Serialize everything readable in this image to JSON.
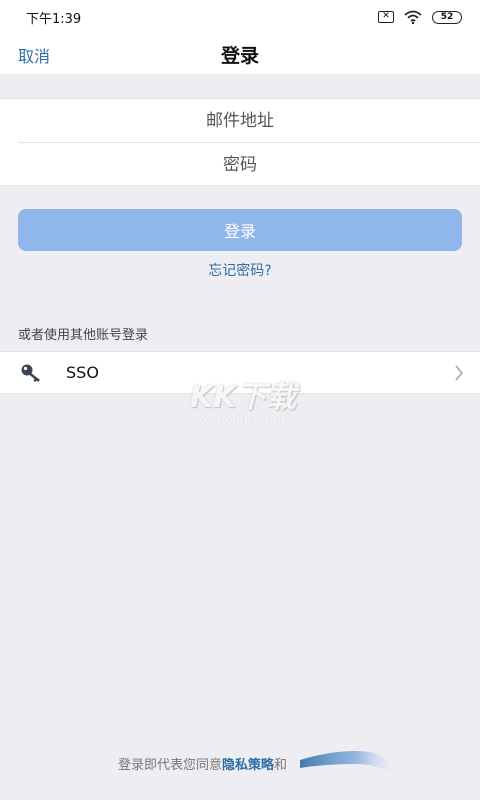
{
  "status_bar": {
    "time": "下午1:39",
    "battery": "52",
    "sim": "✕"
  },
  "nav": {
    "cancel_label": "取消",
    "title": "登录"
  },
  "form": {
    "email_placeholder": "邮件地址",
    "password_placeholder": "密码"
  },
  "login_button_label": "登录",
  "forgot_password_label": "忘记密码?",
  "alt_login": {
    "section_label": "或者使用其他账号登录",
    "sso_label": "SSO"
  },
  "watermark": {
    "logo": "KK下载",
    "url": "www.kkx.net"
  },
  "footer": {
    "prefix": "登录即代表您同意",
    "policy_link": "隐私策略",
    "connector": "和"
  },
  "colors": {
    "accent": "#2e6ea6",
    "button_disabled": "#8fb7ec",
    "background": "#eeeef2"
  }
}
